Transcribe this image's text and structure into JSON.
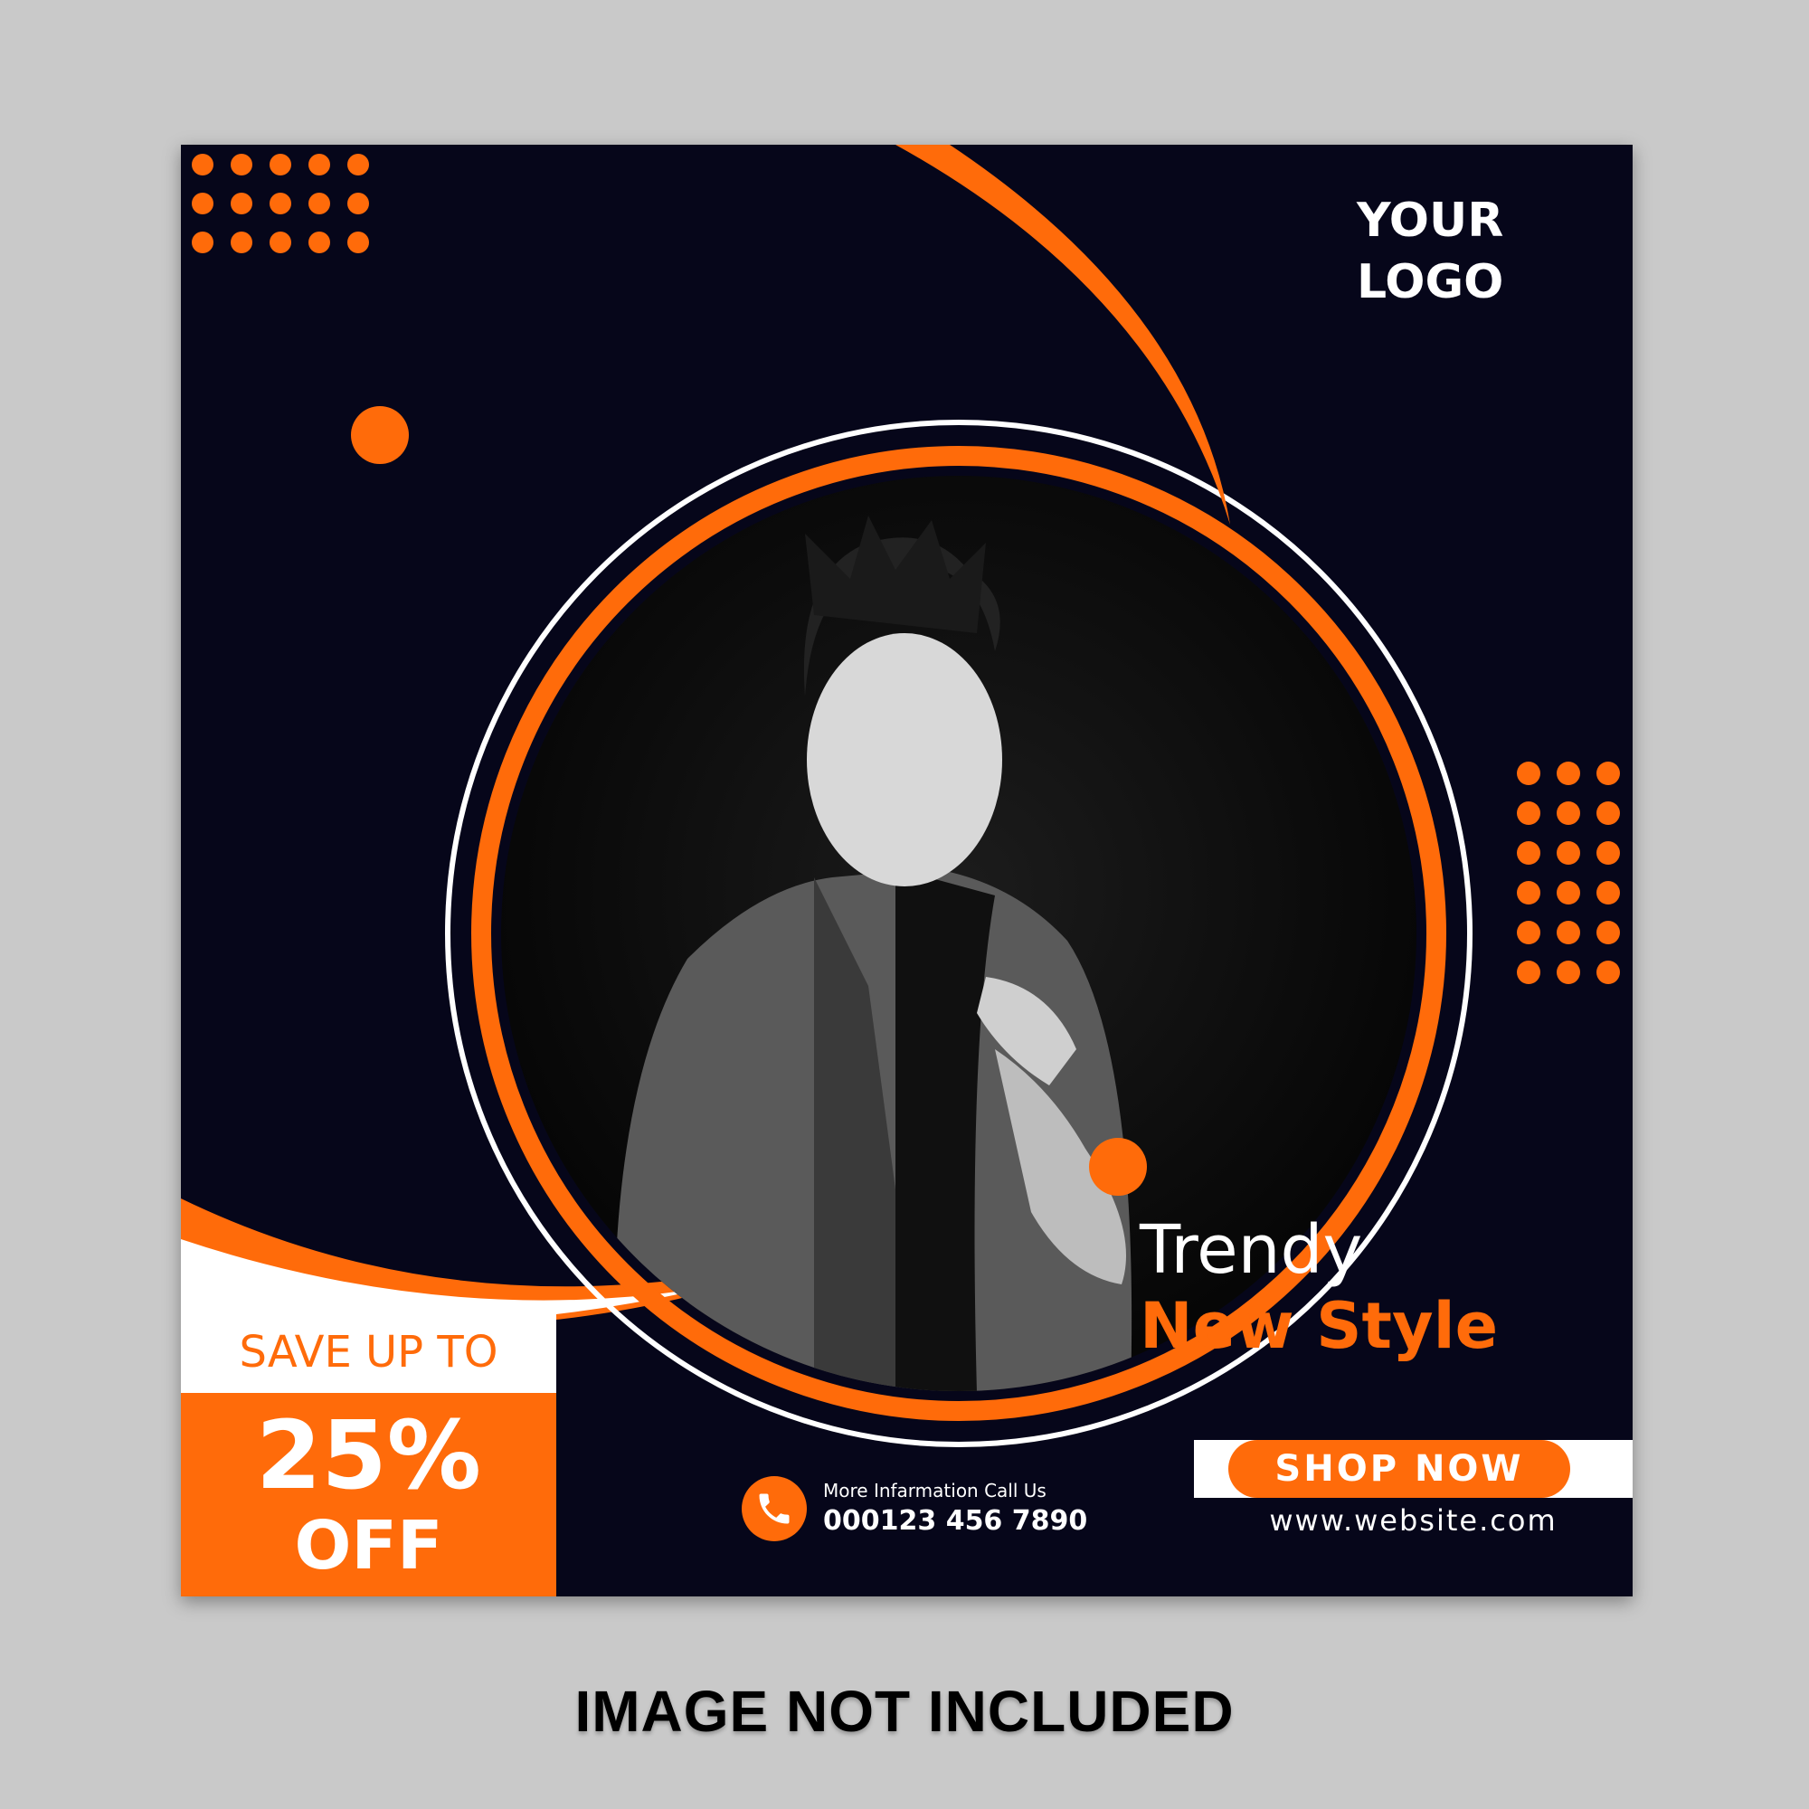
{
  "colors": {
    "background": "#c9c9c9",
    "poster_bg": "#06061a",
    "accent": "#ff6b0a",
    "white": "#ffffff"
  },
  "logo": {
    "line1": "YOUR",
    "line2": "LOGO"
  },
  "headline": {
    "line1": "Trendy",
    "line2": "New Style"
  },
  "offer": {
    "save_label": "SAVE UP TO",
    "percent": "25%",
    "off": "OFF"
  },
  "contact": {
    "icon": "phone-icon",
    "label": "More Infarmation Call Us",
    "number": "000123 456 7890"
  },
  "cta": {
    "label": "SHOP NOW"
  },
  "website": "www.website.com",
  "photo": {
    "description_icon": "person-photo"
  },
  "caption": "IMAGE NOT INCLUDED"
}
